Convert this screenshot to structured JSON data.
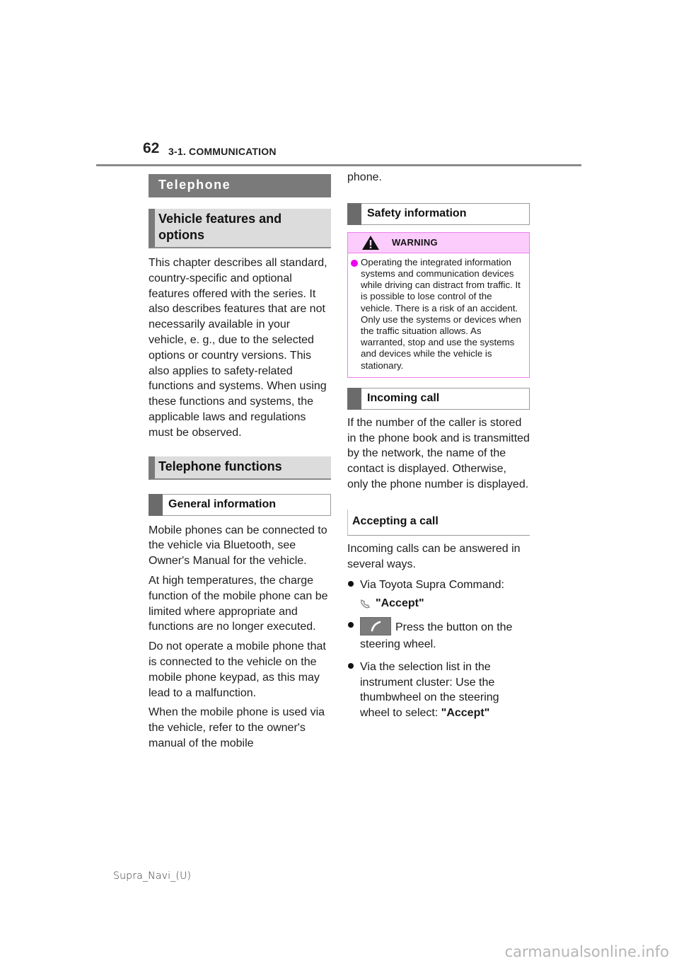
{
  "header": {
    "page_number": "62",
    "chapter": "3-1. COMMUNICATION"
  },
  "left_column": {
    "section_title": "Telephone",
    "subsection_vehicle": "Vehicle features and options",
    "vehicle_text": "This chapter describes all standard, country-specific and optional features offered with the series. It also describes features that are not necessarily available in your vehicle, e. g., due to the selected options or country versions. This also applies to safety-related functions and systems. When using these functions and systems, the applicable laws and regulations must be observed.",
    "subsection_functions": "Telephone functions",
    "general_info_heading": "General information",
    "paragraphs": [
      "Mobile phones can be connected to the vehicle via Bluetooth, see Owner's Manual for the vehicle.",
      "At high temperatures, the charge function of the mobile phone can be limited where appropriate and functions are no longer executed.",
      "Do not operate a mobile phone that is connected to the vehicle on the mobile phone keypad, as this may lead to a malfunction.",
      "When the mobile phone is used via the vehicle, refer to the owner's manual of the mobile"
    ]
  },
  "right_column": {
    "continuation": "phone.",
    "safety_heading": "Safety information",
    "warning": {
      "label": "WARNING",
      "text": "Operating the integrated information systems and communication devices while driving can distract from traffic. It is possible to lose control of the vehicle. There is a risk of an accident. Only use the systems or devices when the traffic situation allows. As warranted, stop and use the systems and devices while the vehicle is stationary.",
      "accent_color": "#ee00ee"
    },
    "incoming_heading": "Incoming call",
    "incoming_text": "If the number of the caller is stored in the phone book and is transmitted by the network, the name of the contact is displayed. Otherwise, only the phone number is displayed.",
    "accepting_heading": "Accepting a call",
    "accepting_intro": "Incoming calls can be answered in several ways.",
    "bullets": [
      {
        "text": "Via Toyota Supra Command:",
        "command_quote_open": "\"",
        "command": "Accept",
        "command_quote_close": "\"",
        "icon": "voice-command-icon"
      },
      {
        "icon": "phone-button-icon",
        "text": "Press the button on the steering wheel."
      },
      {
        "text": "Via the selection list in the instrument cluster: Use the thumbwheel on the steering wheel to select: ",
        "command_quote_open": "\"",
        "command": "Accept",
        "command_quote_close": "\""
      }
    ]
  },
  "footer": {
    "code": "Supra_Navi_(U)",
    "watermark": "carmanualsonline.info"
  }
}
